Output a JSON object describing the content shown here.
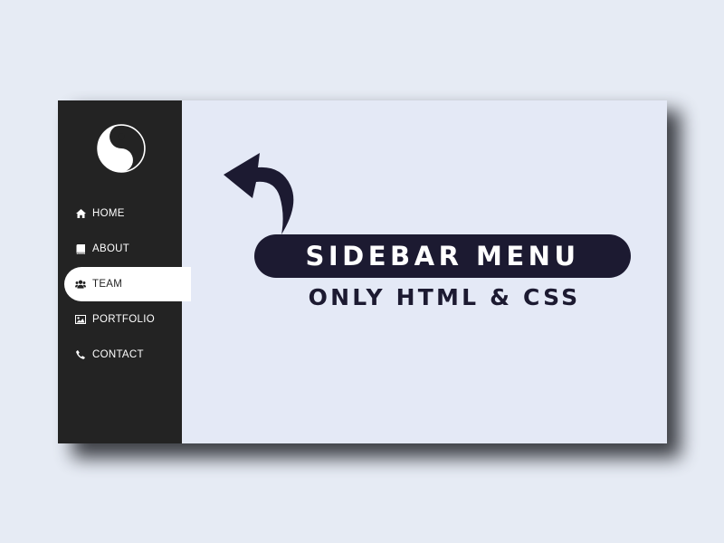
{
  "sidebar": {
    "logo_icon": "yin-yang-icon",
    "items": [
      {
        "label": "HOME",
        "icon": "home-icon",
        "active": false
      },
      {
        "label": "ABOUT",
        "icon": "book-icon",
        "active": false
      },
      {
        "label": "TEAM",
        "icon": "users-icon",
        "active": true
      },
      {
        "label": "PORTFOLIO",
        "icon": "image-icon",
        "active": false
      },
      {
        "label": "CONTACT",
        "icon": "phone-icon",
        "active": false
      }
    ]
  },
  "main": {
    "title": "SIDEBAR MENU",
    "subtitle": "ONLY HTML & CSS"
  },
  "colors": {
    "background": "#e6ebf4",
    "sidebar": "#232323",
    "content": "#e4e9f6",
    "accent": "#1c1a31",
    "active_item": "#ffffff"
  }
}
